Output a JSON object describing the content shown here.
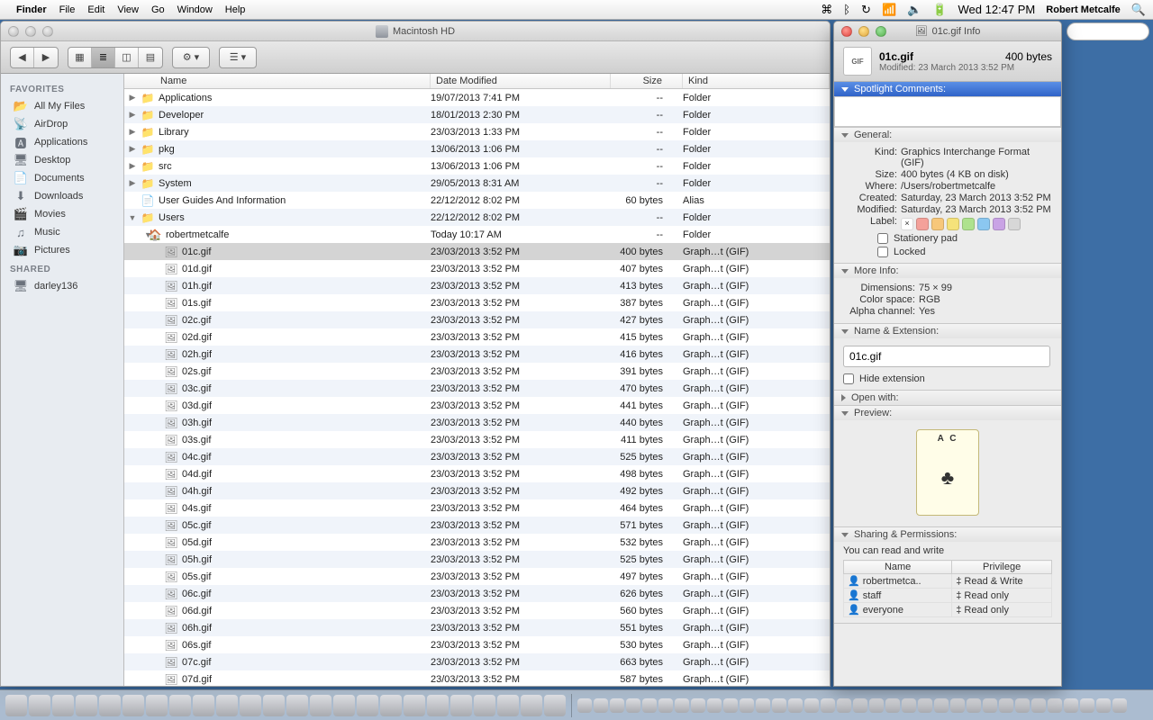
{
  "menubar": {
    "app": "Finder",
    "items": [
      "File",
      "Edit",
      "View",
      "Go",
      "Window",
      "Help"
    ],
    "time": "Wed 12:47 PM",
    "user": "Robert Metcalfe"
  },
  "finder": {
    "title": "Macintosh HD",
    "sidebar": {
      "favorites_label": "FAVORITES",
      "favorites": [
        {
          "icon": "📂",
          "label": "All My Files"
        },
        {
          "icon": "📡",
          "label": "AirDrop"
        },
        {
          "icon": "🅰",
          "label": "Applications"
        },
        {
          "icon": "🖥",
          "label": "Desktop"
        },
        {
          "icon": "📄",
          "label": "Documents"
        },
        {
          "icon": "⬇",
          "label": "Downloads"
        },
        {
          "icon": "🎬",
          "label": "Movies"
        },
        {
          "icon": "♫",
          "label": "Music"
        },
        {
          "icon": "📷",
          "label": "Pictures"
        }
      ],
      "shared_label": "SHARED",
      "shared": [
        {
          "icon": "🖥",
          "label": "darley136"
        }
      ]
    },
    "columns": {
      "name": "Name",
      "date": "Date Modified",
      "size": "Size",
      "kind": "Kind"
    },
    "rows": [
      {
        "d": 0,
        "exp": "▶",
        "ic": "📁",
        "name": "Applications",
        "date": "19/07/2013 7:41 PM",
        "size": "--",
        "kind": "Folder"
      },
      {
        "d": 0,
        "exp": "▶",
        "ic": "📁",
        "name": "Developer",
        "date": "18/01/2013 2:30 PM",
        "size": "--",
        "kind": "Folder"
      },
      {
        "d": 0,
        "exp": "▶",
        "ic": "📁",
        "name": "Library",
        "date": "23/03/2013 1:33 PM",
        "size": "--",
        "kind": "Folder"
      },
      {
        "d": 0,
        "exp": "▶",
        "ic": "📁",
        "name": "pkg",
        "date": "13/06/2013 1:06 PM",
        "size": "--",
        "kind": "Folder"
      },
      {
        "d": 0,
        "exp": "▶",
        "ic": "📁",
        "name": "src",
        "date": "13/06/2013 1:06 PM",
        "size": "--",
        "kind": "Folder"
      },
      {
        "d": 0,
        "exp": "▶",
        "ic": "📁",
        "name": "System",
        "date": "29/05/2013 8:31 AM",
        "size": "--",
        "kind": "Folder"
      },
      {
        "d": 0,
        "exp": "",
        "ic": "📄",
        "name": "User Guides And Information",
        "date": "22/12/2012 8:02 PM",
        "size": "60 bytes",
        "kind": "Alias"
      },
      {
        "d": 0,
        "exp": "▼",
        "ic": "📁",
        "name": "Users",
        "date": "22/12/2012 8:02 PM",
        "size": "--",
        "kind": "Folder"
      },
      {
        "d": 1,
        "exp": "▼",
        "ic": "🏠",
        "name": "robertmetcalfe",
        "date": "Today 10:17 AM",
        "size": "--",
        "kind": "Folder"
      },
      {
        "d": 2,
        "exp": "",
        "ic": "🖼",
        "name": "01c.gif",
        "date": "23/03/2013 3:52 PM",
        "size": "400 bytes",
        "kind": "Graph…t (GIF)",
        "sel": true
      },
      {
        "d": 2,
        "exp": "",
        "ic": "🖼",
        "name": "01d.gif",
        "date": "23/03/2013 3:52 PM",
        "size": "407 bytes",
        "kind": "Graph…t (GIF)"
      },
      {
        "d": 2,
        "exp": "",
        "ic": "🖼",
        "name": "01h.gif",
        "date": "23/03/2013 3:52 PM",
        "size": "413 bytes",
        "kind": "Graph…t (GIF)"
      },
      {
        "d": 2,
        "exp": "",
        "ic": "🖼",
        "name": "01s.gif",
        "date": "23/03/2013 3:52 PM",
        "size": "387 bytes",
        "kind": "Graph…t (GIF)"
      },
      {
        "d": 2,
        "exp": "",
        "ic": "🖼",
        "name": "02c.gif",
        "date": "23/03/2013 3:52 PM",
        "size": "427 bytes",
        "kind": "Graph…t (GIF)"
      },
      {
        "d": 2,
        "exp": "",
        "ic": "🖼",
        "name": "02d.gif",
        "date": "23/03/2013 3:52 PM",
        "size": "415 bytes",
        "kind": "Graph…t (GIF)"
      },
      {
        "d": 2,
        "exp": "",
        "ic": "🖼",
        "name": "02h.gif",
        "date": "23/03/2013 3:52 PM",
        "size": "416 bytes",
        "kind": "Graph…t (GIF)"
      },
      {
        "d": 2,
        "exp": "",
        "ic": "🖼",
        "name": "02s.gif",
        "date": "23/03/2013 3:52 PM",
        "size": "391 bytes",
        "kind": "Graph…t (GIF)"
      },
      {
        "d": 2,
        "exp": "",
        "ic": "🖼",
        "name": "03c.gif",
        "date": "23/03/2013 3:52 PM",
        "size": "470 bytes",
        "kind": "Graph…t (GIF)"
      },
      {
        "d": 2,
        "exp": "",
        "ic": "🖼",
        "name": "03d.gif",
        "date": "23/03/2013 3:52 PM",
        "size": "441 bytes",
        "kind": "Graph…t (GIF)"
      },
      {
        "d": 2,
        "exp": "",
        "ic": "🖼",
        "name": "03h.gif",
        "date": "23/03/2013 3:52 PM",
        "size": "440 bytes",
        "kind": "Graph…t (GIF)"
      },
      {
        "d": 2,
        "exp": "",
        "ic": "🖼",
        "name": "03s.gif",
        "date": "23/03/2013 3:52 PM",
        "size": "411 bytes",
        "kind": "Graph…t (GIF)"
      },
      {
        "d": 2,
        "exp": "",
        "ic": "🖼",
        "name": "04c.gif",
        "date": "23/03/2013 3:52 PM",
        "size": "525 bytes",
        "kind": "Graph…t (GIF)"
      },
      {
        "d": 2,
        "exp": "",
        "ic": "🖼",
        "name": "04d.gif",
        "date": "23/03/2013 3:52 PM",
        "size": "498 bytes",
        "kind": "Graph…t (GIF)"
      },
      {
        "d": 2,
        "exp": "",
        "ic": "🖼",
        "name": "04h.gif",
        "date": "23/03/2013 3:52 PM",
        "size": "492 bytes",
        "kind": "Graph…t (GIF)"
      },
      {
        "d": 2,
        "exp": "",
        "ic": "🖼",
        "name": "04s.gif",
        "date": "23/03/2013 3:52 PM",
        "size": "464 bytes",
        "kind": "Graph…t (GIF)"
      },
      {
        "d": 2,
        "exp": "",
        "ic": "🖼",
        "name": "05c.gif",
        "date": "23/03/2013 3:52 PM",
        "size": "571 bytes",
        "kind": "Graph…t (GIF)"
      },
      {
        "d": 2,
        "exp": "",
        "ic": "🖼",
        "name": "05d.gif",
        "date": "23/03/2013 3:52 PM",
        "size": "532 bytes",
        "kind": "Graph…t (GIF)"
      },
      {
        "d": 2,
        "exp": "",
        "ic": "🖼",
        "name": "05h.gif",
        "date": "23/03/2013 3:52 PM",
        "size": "525 bytes",
        "kind": "Graph…t (GIF)"
      },
      {
        "d": 2,
        "exp": "",
        "ic": "🖼",
        "name": "05s.gif",
        "date": "23/03/2013 3:52 PM",
        "size": "497 bytes",
        "kind": "Graph…t (GIF)"
      },
      {
        "d": 2,
        "exp": "",
        "ic": "🖼",
        "name": "06c.gif",
        "date": "23/03/2013 3:52 PM",
        "size": "626 bytes",
        "kind": "Graph…t (GIF)"
      },
      {
        "d": 2,
        "exp": "",
        "ic": "🖼",
        "name": "06d.gif",
        "date": "23/03/2013 3:52 PM",
        "size": "560 bytes",
        "kind": "Graph…t (GIF)"
      },
      {
        "d": 2,
        "exp": "",
        "ic": "🖼",
        "name": "06h.gif",
        "date": "23/03/2013 3:52 PM",
        "size": "551 bytes",
        "kind": "Graph…t (GIF)"
      },
      {
        "d": 2,
        "exp": "",
        "ic": "🖼",
        "name": "06s.gif",
        "date": "23/03/2013 3:52 PM",
        "size": "530 bytes",
        "kind": "Graph…t (GIF)"
      },
      {
        "d": 2,
        "exp": "",
        "ic": "🖼",
        "name": "07c.gif",
        "date": "23/03/2013 3:52 PM",
        "size": "663 bytes",
        "kind": "Graph…t (GIF)"
      },
      {
        "d": 2,
        "exp": "",
        "ic": "🖼",
        "name": "07d.gif",
        "date": "23/03/2013 3:52 PM",
        "size": "587 bytes",
        "kind": "Graph…t (GIF)"
      }
    ]
  },
  "info": {
    "title": "01c.gif Info",
    "name": "01c.gif",
    "size": "400 bytes",
    "modified_sub": "Modified: 23 March 2013 3:52 PM",
    "spotlight_label": "Spotlight Comments:",
    "general_label": "General:",
    "general": {
      "kind_k": "Kind:",
      "kind_v": "Graphics Interchange Format (GIF)",
      "size_k": "Size:",
      "size_v": "400 bytes (4 KB on disk)",
      "where_k": "Where:",
      "where_v": "/Users/robertmetcalfe",
      "created_k": "Created:",
      "created_v": "Saturday, 23 March 2013 3:52 PM",
      "modified_k": "Modified:",
      "modified_v": "Saturday, 23 March 2013 3:52 PM",
      "label_k": "Label:"
    },
    "stationery": "Stationery pad",
    "locked": "Locked",
    "moreinfo_label": "More Info:",
    "moreinfo": {
      "dim_k": "Dimensions:",
      "dim_v": "75 × 99",
      "cs_k": "Color space:",
      "cs_v": "RGB",
      "ac_k": "Alpha channel:",
      "ac_v": "Yes"
    },
    "nameext_label": "Name & Extension:",
    "name_input": "01c.gif",
    "hide_ext": "Hide extension",
    "openwith_label": "Open with:",
    "preview_label": "Preview:",
    "preview_corner": "A  C",
    "preview_suit": "♣",
    "perms_label": "Sharing & Permissions:",
    "perms_note": "You can read and write",
    "perms_cols": {
      "name": "Name",
      "priv": "Privilege"
    },
    "perms_rows": [
      {
        "u": "robertmetca..",
        "p": "Read & Write"
      },
      {
        "u": "staff",
        "p": "Read only"
      },
      {
        "u": "everyone",
        "p": "Read only"
      }
    ]
  },
  "label_colors": [
    "#ffffff",
    "#f4a19a",
    "#f7c77a",
    "#f5e27a",
    "#aee28e",
    "#8bc7f0",
    "#c9a3e5",
    "#d7d7d7"
  ]
}
